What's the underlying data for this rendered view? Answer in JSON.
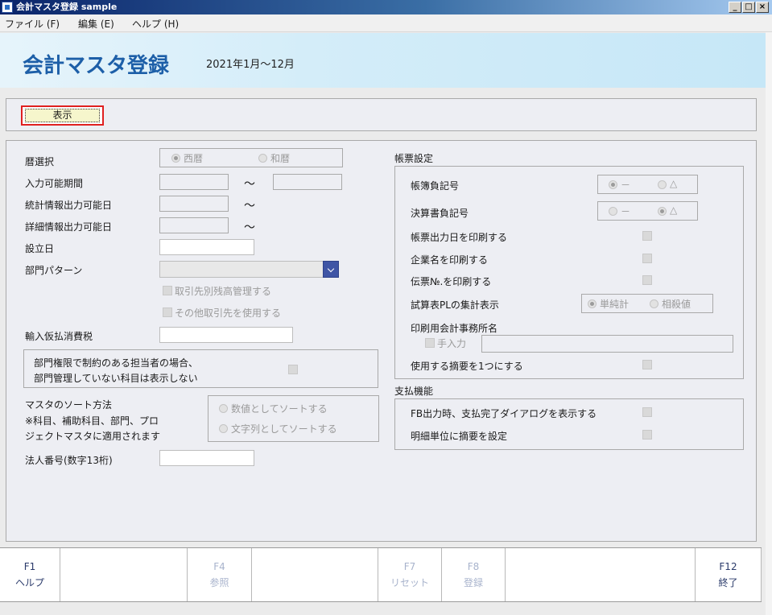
{
  "window": {
    "title": "会計マスタ登録 sample",
    "controls": {
      "minimize": "_",
      "maximize": "□",
      "close": "×"
    }
  },
  "menu": [
    {
      "label": "ファイル (F)"
    },
    {
      "label": "編集 (E)"
    },
    {
      "label": "ヘルプ (H)"
    }
  ],
  "header": {
    "title": "会計マスタ登録",
    "period": "2021年1月～12月"
  },
  "toolbar": {
    "display_label": "表示"
  },
  "left": {
    "calendar": {
      "label": "暦選択",
      "options": [
        "西暦",
        "和暦"
      ],
      "selected": "西暦"
    },
    "input_period": {
      "label": "入力可能期間",
      "tilde": "～"
    },
    "stats_output_date": {
      "label": "統計情報出力可能日",
      "tilde": "～"
    },
    "detail_output_date": {
      "label": "詳細情報出力可能日",
      "tilde": "～"
    },
    "established": {
      "label": "設立日"
    },
    "dept_pattern": {
      "label": "部門パターン",
      "value": ""
    },
    "partner_balance": {
      "label": "取引先別残高管理する"
    },
    "other_partner": {
      "label": "その他取引先を使用する"
    },
    "import_tax": {
      "label": "輸入仮払消費税"
    },
    "dept_restriction": {
      "line1": "部門権限で制約のある担当者の場合、",
      "line2": "部門管理していない科目は表示しない"
    },
    "sort": {
      "label1": "マスタのソート方法",
      "label2": "※科目、補助科目、部門、プロ",
      "label3": "ジェクトマスタに適用されます",
      "options": [
        "数値としてソートする",
        "文字列としてソートする"
      ],
      "selected": null
    },
    "corp_number": {
      "label": "法人番号(数字13桁)"
    }
  },
  "right": {
    "forms_section": "帳票設定",
    "ledger_sign": {
      "label": "帳簿負記号",
      "options": [
        "－",
        "△"
      ],
      "selected": "－"
    },
    "statement_sign": {
      "label": "決算書負記号",
      "options": [
        "－",
        "△"
      ],
      "selected": "△"
    },
    "print_output_date": {
      "label": "帳票出力日を印刷する"
    },
    "print_company": {
      "label": "企業名を印刷する"
    },
    "print_slip_no": {
      "label": "伝票№.を印刷する"
    },
    "trial_pl": {
      "label": "試算表PLの集計表示",
      "options": [
        "単純計",
        "相殺値"
      ],
      "selected": "単純計"
    },
    "print_office": {
      "label": "印刷用会計事務所名",
      "manual_label": "手入力"
    },
    "single_summary": {
      "label": "使用する摘要を1つにする"
    },
    "payment_section": "支払機能",
    "fb_dialog": {
      "label": "FB出力時、支払完了ダイアログを表示する"
    },
    "detail_summary": {
      "label": "明細単位に摘要を設定"
    }
  },
  "fkeys": [
    {
      "key": "F1",
      "label": "ヘルプ",
      "enabled": true
    },
    {
      "key": "",
      "label": "",
      "enabled": false
    },
    {
      "key": "F4",
      "label": "参照",
      "enabled": false
    },
    {
      "key": "",
      "label": "",
      "enabled": false
    },
    {
      "key": "F7",
      "label": "リセット",
      "enabled": false
    },
    {
      "key": "F8",
      "label": "登録",
      "enabled": false
    },
    {
      "key": "",
      "label": "",
      "enabled": false
    },
    {
      "key": "F12",
      "label": "終了",
      "enabled": true
    }
  ],
  "colors": {
    "title_bar_start": "#0a246a",
    "header_title": "#1d5fa8",
    "highlight_border": "#e02020",
    "dropdown_button": "#3f55a5"
  }
}
